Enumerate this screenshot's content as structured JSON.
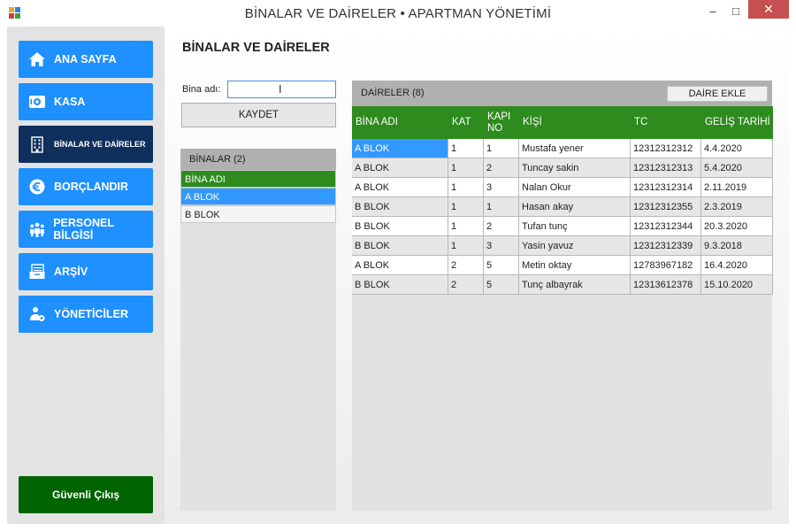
{
  "window": {
    "title": "BİNALAR VE DAİRELER • APARTMAN YÖNETİMİ",
    "minimize": "–",
    "maximize": "□",
    "close": "✕"
  },
  "sidebar": {
    "items": [
      {
        "label": "ANA SAYFA",
        "icon": "home-icon"
      },
      {
        "label": "KASA",
        "icon": "safe-icon"
      },
      {
        "label": "BİNALAR VE DAİRELER",
        "icon": "building-icon"
      },
      {
        "label": "BORÇLANDIR",
        "icon": "debt-icon"
      },
      {
        "label": "PERSONEL BİLGİSİ",
        "icon": "people-icon"
      },
      {
        "label": "ARŞİV",
        "icon": "archive-icon"
      },
      {
        "label": "YÖNETİCİLER",
        "icon": "admin-icon"
      }
    ],
    "active_index": 2,
    "exit_label": "Güvenli Çıkış",
    "colors": {
      "button": "#1e90ff",
      "active": "#0f2f5c",
      "exit": "#006400"
    }
  },
  "main": {
    "title": "BİNALAR VE DAİRELER",
    "bina_label": "Bina adı:",
    "bina_value": "",
    "save_label": "KAYDET"
  },
  "binalar": {
    "title": "BİNALAR",
    "count": "(2)",
    "header": "BİNA ADI",
    "rows": [
      "A BLOK",
      "B BLOK"
    ],
    "selected_index": 0
  },
  "daireler": {
    "title": "DAİRELER",
    "count": "(8)",
    "add_label": "DAİRE EKLE",
    "columns": [
      "BİNA ADI",
      "KAT",
      "KAPI NO",
      "KİŞİ",
      "TC",
      "GELİŞ TARİHİ"
    ],
    "rows": [
      [
        "A BLOK",
        "1",
        "1",
        "Mustafa yener",
        "12312312312",
        "4.4.2020"
      ],
      [
        "A BLOK",
        "1",
        "2",
        "Tuncay sakin",
        "12312312313",
        "5.4.2020"
      ],
      [
        "A BLOK",
        "1",
        "3",
        "Nalan Okur",
        "12312312314",
        "2.11.2019"
      ],
      [
        "B BLOK",
        "1",
        "1",
        "Hasan akay",
        "12312312355",
        "2.3.2019"
      ],
      [
        "B BLOK",
        "1",
        "2",
        "Tufan tunç",
        "12312312344",
        "20.3.2020"
      ],
      [
        "B BLOK",
        "1",
        "3",
        "Yasin yavuz",
        "12312312339",
        "9.3.2018"
      ],
      [
        "A BLOK",
        "2",
        "5",
        "Metin oktay",
        "12783967182",
        "16.4.2020"
      ],
      [
        "B BLOK",
        "2",
        "5",
        "Tunç albayrak",
        "12313612378",
        "15.10.2020"
      ]
    ],
    "selected_cell": [
      0,
      0
    ],
    "colors": {
      "header": "#2e8b1e",
      "selection": "#3399ff"
    }
  }
}
